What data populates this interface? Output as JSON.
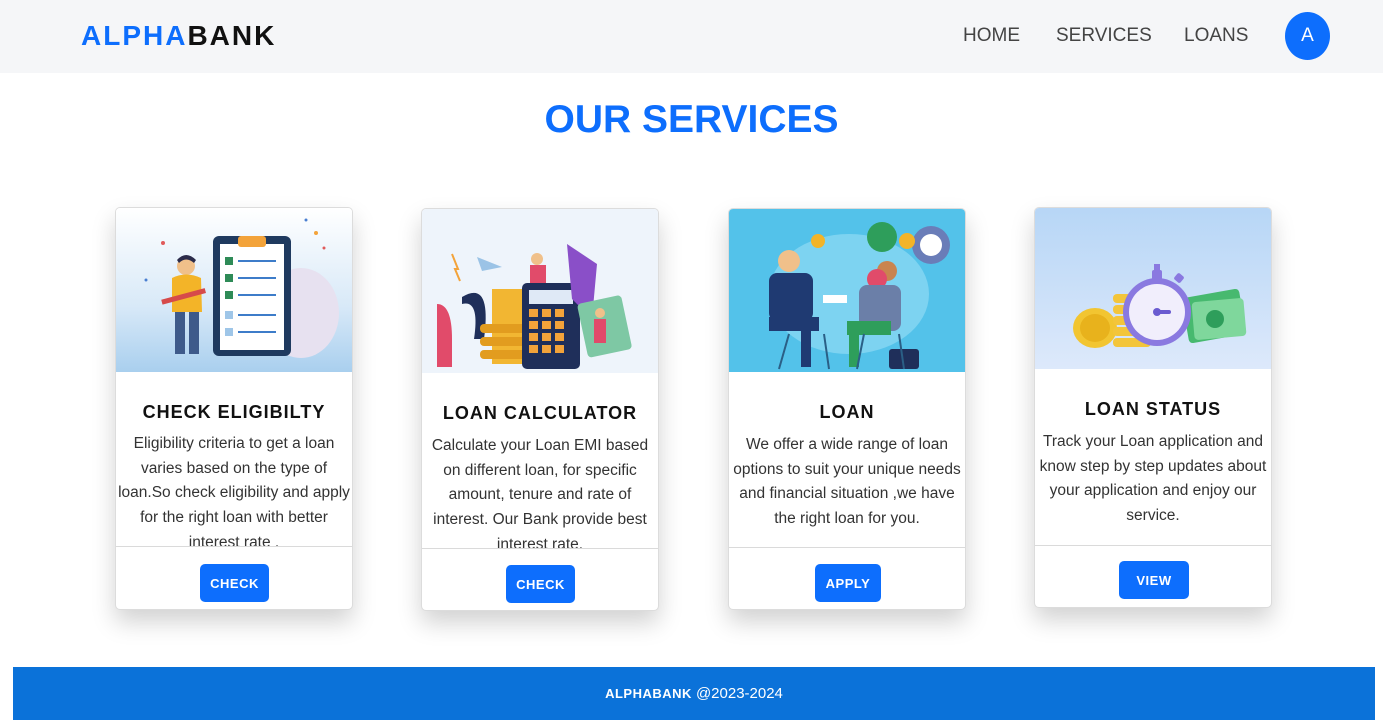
{
  "navbar": {
    "brand_part1": "ALPHA",
    "brand_part2": "BANK",
    "links": [
      "HOME",
      "SERVICES",
      "LOANS"
    ],
    "avatar_initial": "A"
  },
  "page_title": "OUR SERVICES",
  "cards": [
    {
      "title": "CHECK ELIGIBILTY",
      "text": "Eligibility criteria to get a loan varies based on the type of loan.So check eligibility and apply for the right loan with better interest rate .",
      "button": "CHECK"
    },
    {
      "title": "LOAN CALCULATOR",
      "text": "Calculate your Loan EMI based on different loan, for specific amount, tenure and rate of interest. Our Bank provide best interest rate.",
      "button": "CHECK"
    },
    {
      "title": "LOAN",
      "text": "We offer a wide range of loan options to suit your unique needs and financial situation ,we have the right loan for you.",
      "button": "APPLY"
    },
    {
      "title": "LOAN STATUS",
      "text": "Track your Loan application and know step by step updates about your application and enjoy our service.",
      "button": "VIEW"
    }
  ],
  "footer": {
    "brand": "ALPHABANK",
    "years": "@2023-2024"
  },
  "colors": {
    "accent": "#0d6efd",
    "footer_bg": "#0b72d9",
    "navbar_bg": "#f5f6f8"
  }
}
